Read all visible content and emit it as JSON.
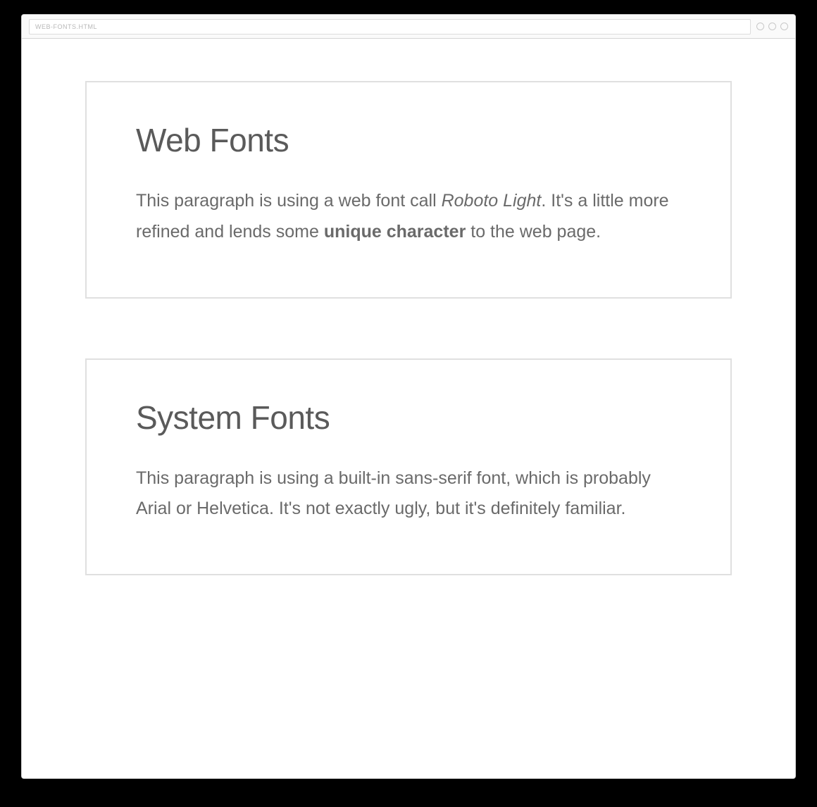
{
  "browser": {
    "address": "WEB-FONTS.HTML"
  },
  "cards": {
    "web_fonts": {
      "heading": "Web Fonts",
      "paragraph_part1": "This paragraph is using a web font call ",
      "italic_text": "Roboto Light",
      "paragraph_part2": ". It's a little more refined and lends some ",
      "bold_text": "unique character",
      "paragraph_part3": " to the web page."
    },
    "system_fonts": {
      "heading": "System Fonts",
      "paragraph": "This paragraph is using a built-in sans-serif font, which is probably Arial or Helvetica. It's not exactly ugly, but it's definitely familiar."
    }
  }
}
